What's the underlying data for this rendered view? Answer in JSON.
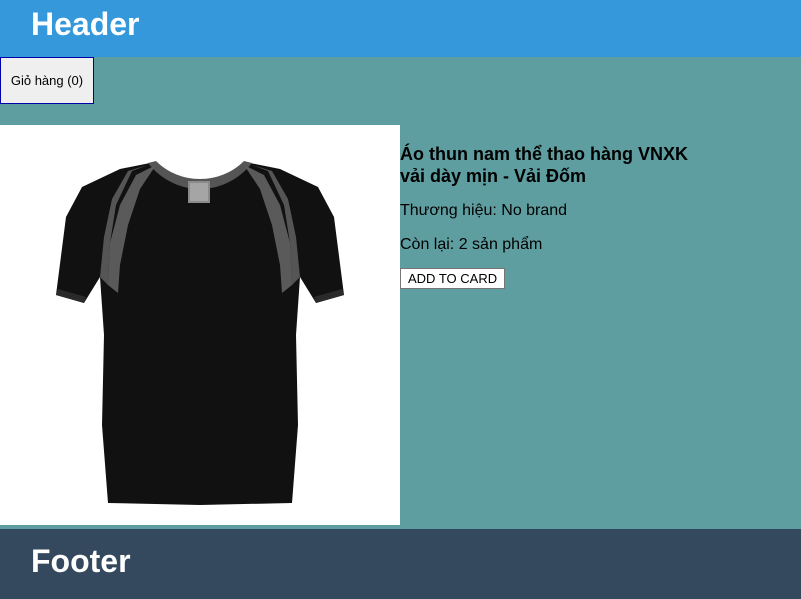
{
  "header": {
    "title": "Header"
  },
  "cart": {
    "label": "Giỏ hàng (0)"
  },
  "product": {
    "image_icon": "black-tshirt-image",
    "title_line1": "Áo thun nam thể thao hàng VNXK",
    "title_line2": "vải dày mịn - Vải Đốm",
    "brand": "Thương hiệu: No brand",
    "stock": "Còn lại: 2 sản phẩm",
    "add_label": "ADD TO CARD"
  },
  "footer": {
    "title": "Footer"
  },
  "colors": {
    "header_bg": "#3498db",
    "page_bg": "#5f9ea0",
    "footer_bg": "#34495e",
    "shirt_body": "#111111",
    "shirt_accent": "#5a5a5a"
  }
}
